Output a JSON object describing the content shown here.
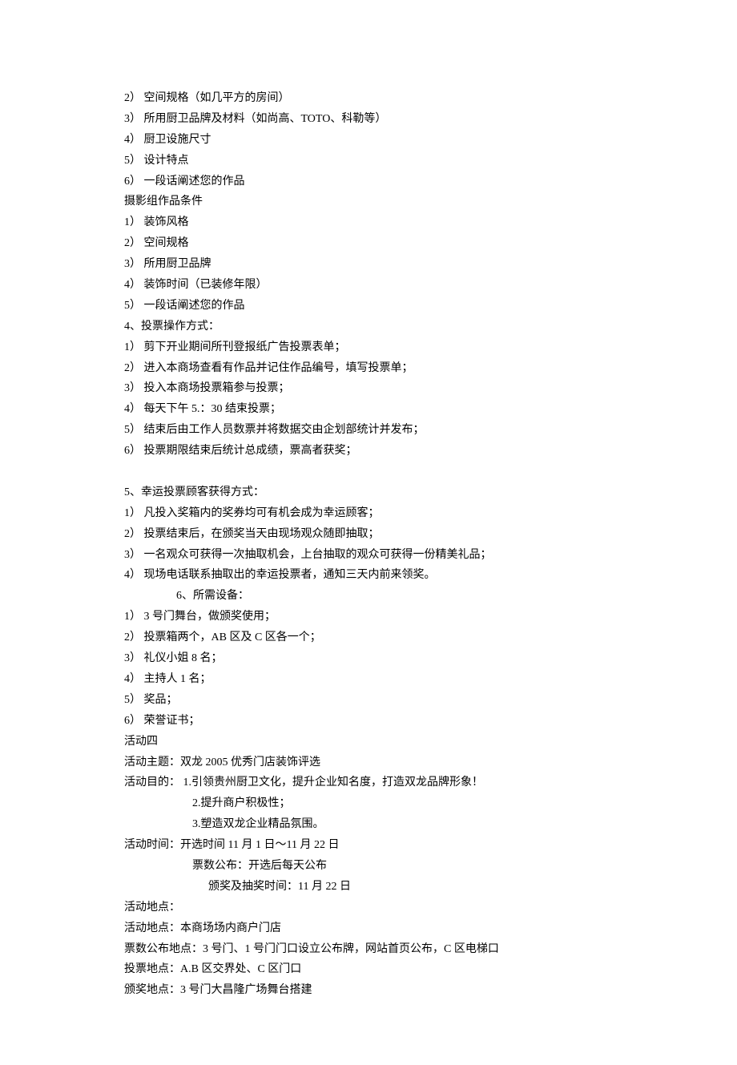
{
  "lines": [
    {
      "text": "2） 空间规格（如几平方的房间）",
      "cls": "line"
    },
    {
      "text": "3） 所用厨卫品牌及材料（如尚高、TOTO、科勒等）",
      "cls": "line"
    },
    {
      "text": "4） 厨卫设施尺寸",
      "cls": "line"
    },
    {
      "text": "5） 设计特点",
      "cls": "line"
    },
    {
      "text": "6） 一段话阐述您的作品",
      "cls": "line"
    },
    {
      "text": "摄影组作品条件",
      "cls": "line"
    },
    {
      "text": "1） 装饰风格",
      "cls": "line"
    },
    {
      "text": "2） 空间规格",
      "cls": "line"
    },
    {
      "text": "3） 所用厨卫品牌",
      "cls": "line"
    },
    {
      "text": "4） 装饰时间（已装修年限）",
      "cls": "line"
    },
    {
      "text": "5） 一段话阐述您的作品",
      "cls": "line"
    },
    {
      "text": "4、投票操作方式：",
      "cls": "line"
    },
    {
      "text": "1） 剪下开业期间所刊登报纸广告投票表单；",
      "cls": "line"
    },
    {
      "text": "2） 进入本商场查看有作品并记住作品编号，填写投票单；",
      "cls": "line"
    },
    {
      "text": "3） 投入本商场投票箱参与投票；",
      "cls": "line"
    },
    {
      "text": "4） 每天下午 5.：30 结束投票；",
      "cls": "line"
    },
    {
      "text": "5） 结束后由工作人员数票并将数据交由企划部统计并发布；",
      "cls": "line"
    },
    {
      "text": "6） 投票期限结束后统计总成绩，票高者获奖；",
      "cls": "line"
    },
    {
      "text": "",
      "cls": "line blank"
    },
    {
      "text": "5、幸运投票顾客获得方式：",
      "cls": "line"
    },
    {
      "text": "1） 凡投入奖箱内的奖券均可有机会成为幸运顾客；",
      "cls": "line"
    },
    {
      "text": "2） 投票结束后，在颁奖当天由现场观众随即抽取；",
      "cls": "line"
    },
    {
      "text": "3） 一名观众可获得一次抽取机会，上台抽取的观众可获得一份精美礼品；",
      "cls": "line"
    },
    {
      "text": "4） 现场电话联系抽取出的幸运投票者，通知三天内前来领奖。",
      "cls": "line"
    },
    {
      "text": "6、所需设备：",
      "cls": "line indent1"
    },
    {
      "text": "1） 3 号门舞台，做颁奖使用；",
      "cls": "line"
    },
    {
      "text": "2） 投票箱两个，AB 区及 C 区各一个；",
      "cls": "line"
    },
    {
      "text": "3） 礼仪小姐 8 名；",
      "cls": "line"
    },
    {
      "text": "4） 主持人 1 名；",
      "cls": "line"
    },
    {
      "text": "5） 奖品；",
      "cls": "line"
    },
    {
      "text": "6） 荣誉证书；",
      "cls": "line"
    },
    {
      "text": "活动四",
      "cls": "line"
    },
    {
      "text": "活动主题：双龙 2005 优秀门店装饰评选",
      "cls": "line"
    },
    {
      "text": "活动目的： 1.引领贵州厨卫文化，提升企业知名度，打造双龙品牌形象！",
      "cls": "line"
    },
    {
      "text": "2.提升商户积极性；",
      "cls": "line indent2"
    },
    {
      "text": "3.塑造双龙企业精品氛围。",
      "cls": "line indent2"
    },
    {
      "text": "活动时间：开选时间 11 月 1 日～11 月 22 日",
      "cls": "line"
    },
    {
      "text": "票数公布：开选后每天公布",
      "cls": "line indent2"
    },
    {
      "text": "颁奖及抽奖时间：11 月 22 日",
      "cls": "line indent3"
    },
    {
      "text": " 活动地点：",
      "cls": "line"
    },
    {
      "text": "活动地点：本商场场内商户门店",
      "cls": "line"
    },
    {
      "text": "票数公布地点：3 号门、1 号门门口设立公布牌，网站首页公布，C 区电梯口",
      "cls": "line"
    },
    {
      "text": "投票地点：A.B 区交界处、C 区门口",
      "cls": "line"
    },
    {
      "text": "颁奖地点：3 号门大昌隆广场舞台搭建",
      "cls": "line"
    }
  ]
}
